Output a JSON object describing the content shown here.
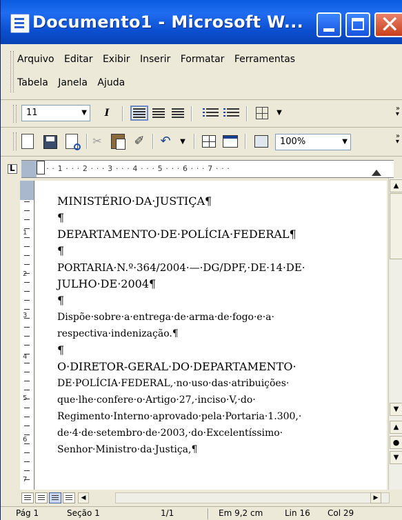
{
  "window": {
    "title": "Documento1 - Microsoft W...",
    "minimize_label": "",
    "maximize_label": "",
    "close_glyph": "✕"
  },
  "menu": {
    "row1": [
      "Arquivo",
      "Editar",
      "Exibir",
      "Inserir",
      "Formatar",
      "Ferramentas"
    ],
    "row2": [
      "Tabela",
      "Janela",
      "Ajuda"
    ]
  },
  "formatting_toolbar": {
    "font_size": "11",
    "italic_label": "I",
    "dropdown_glyph": "▼"
  },
  "standard_toolbar": {
    "zoom": "100%",
    "undo_glyph": "↶",
    "cut_glyph": "✂",
    "brush_glyph": "✐"
  },
  "ruler": {
    "horizontal_text": "· · · 1 · · · 2 · · · 3 · · · 4 · · · 5 · · · 6 · · · 7 · · ·",
    "vertical_numbers": [
      "1",
      "2",
      "3",
      "4",
      "5",
      "6",
      "7"
    ]
  },
  "document": {
    "paragraphs": [
      "MINISTÉRIO·DA·JUSTIÇA¶",
      "¶",
      "DEPARTAMENTO·DE·POLÍCIA·FEDERAL¶",
      "¶",
      "PORTARIA·N.º·364/2004·—·DG/DPF,·DE·14·DE·",
      "JULHO·DE·2004¶",
      "¶",
      "Dispõe·sobre·a·entrega·de·arma·de·fogo·e·a·",
      "respectiva·indenização.¶",
      "¶",
      "O·DIRETOR-GERAL·DO·DEPARTAMENTO·",
      "DE·POLÍCIA·FEDERAL,·no·uso·das·atribuições·",
      "que·lhe·confere·o·Artigo·27,·inciso·V,·do·",
      "Regimento·Interno·aprovado·pela·Portaria·1.300,·",
      "de·4·de·setembro·de·2003,·do·Excelentíssimo·",
      "Senhor·Ministro·da·Justiça,¶"
    ]
  },
  "scrollbar": {
    "up": "▲",
    "down": "▼",
    "prev_page": "▲",
    "select_browse": "●",
    "next_page": "▼"
  },
  "hscroll": {
    "left": "◀",
    "right": "▶"
  },
  "status": {
    "page": "Pág 1",
    "section": "Seção 1",
    "page_of": "1/1",
    "position": "Em 9,2 cm",
    "line": "Lin 16",
    "column": "Col 29"
  }
}
